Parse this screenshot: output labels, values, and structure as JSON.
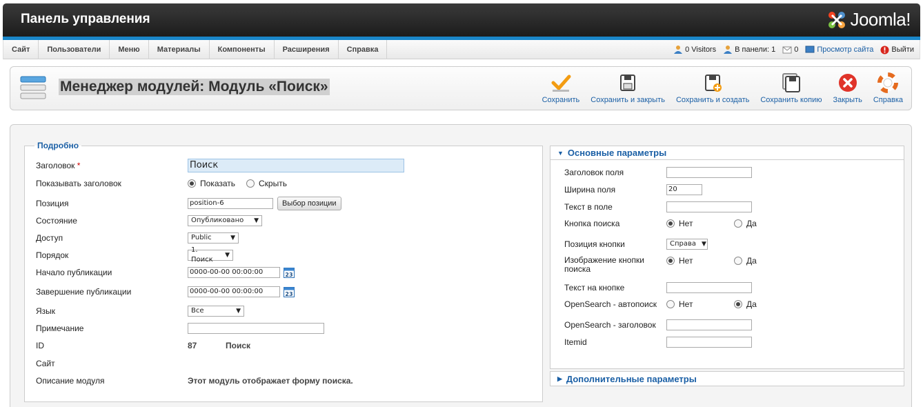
{
  "header": {
    "title": "Панель управления",
    "logo_text": "Joomla!"
  },
  "menu": [
    "Сайт",
    "Пользователи",
    "Меню",
    "Материалы",
    "Компоненты",
    "Расширения",
    "Справка"
  ],
  "status": {
    "visitors": "0 Visitors",
    "admins": "В панели: 1",
    "messages": "0",
    "preview": "Просмотр сайта",
    "logout": "Выйти"
  },
  "page": {
    "title": "Менеджер модулей: Модуль «Поиск»"
  },
  "toolbar": {
    "save": "Сохранить",
    "save_close": "Сохранить и закрыть",
    "save_new": "Сохранить и создать",
    "save_copy": "Сохранить копию",
    "close": "Закрыть",
    "help": "Справка"
  },
  "details": {
    "legend": "Подробно",
    "title_label": "Заголовок",
    "title_value": "Поиск",
    "show_title_label": "Показывать заголовок",
    "show_option": "Показать",
    "hide_option": "Скрыть",
    "position_label": "Позиция",
    "position_value": "position-6",
    "position_button": "Выбор позиции",
    "state_label": "Состояние",
    "state_value": "Опубликовано",
    "access_label": "Доступ",
    "access_value": "Public",
    "order_label": "Порядок",
    "order_value": "1. Поиск",
    "publish_up_label": "Начало публикации",
    "publish_up_value": "0000-00-00 00:00:00",
    "publish_down_label": "Завершение публикации",
    "publish_down_value": "0000-00-00 00:00:00",
    "calendar_day": "23",
    "language_label": "Язык",
    "language_value": "Все",
    "note_label": "Примечание",
    "note_value": "",
    "id_label": "ID",
    "id_value": "87",
    "id_name": "Поиск",
    "site_label": "Сайт",
    "desc_label": "Описание модуля",
    "desc_value": "Этот модуль отображает форму поиска."
  },
  "params": {
    "heading": "Основные параметры",
    "field_label_label": "Заголовок поля",
    "field_label_value": "",
    "width_label": "Ширина поля",
    "width_value": "20",
    "text_label": "Текст в поле",
    "text_value": "",
    "button_label": "Кнопка поиска",
    "no": "Нет",
    "yes": "Да",
    "button_pos_label": "Позиция кнопки",
    "button_pos_value": "Справа",
    "image_button_label": "Изображение кнопки поиска",
    "button_text_label": "Текст на кнопке",
    "button_text_value": "",
    "opensearch_label": "OpenSearch - автопоиск",
    "opensearch_title_label": "OpenSearch - заголовок",
    "opensearch_title_value": "",
    "itemid_label": "Itemid",
    "itemid_value": ""
  },
  "advanced": {
    "heading": "Дополнительные параметры"
  }
}
